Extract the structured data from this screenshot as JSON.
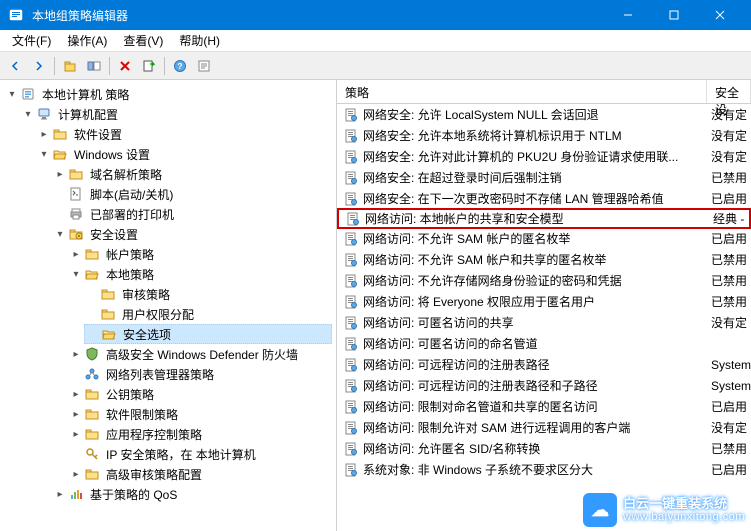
{
  "window": {
    "title": "本地组策略编辑器"
  },
  "menu": {
    "file": "文件(F)",
    "action": "操作(A)",
    "view": "查看(V)",
    "help": "帮助(H)"
  },
  "tree": {
    "root": "本地计算机 策略",
    "computer_config": "计算机配置",
    "software_settings": "软件设置",
    "windows_settings": "Windows 设置",
    "name_resolution": "域名解析策略",
    "scripts": "脚本(启动/关机)",
    "deployed_printers": "已部署的打印机",
    "security_settings": "安全设置",
    "account_policies": "帐户策略",
    "local_policies": "本地策略",
    "audit_policy": "审核策略",
    "user_rights": "用户权限分配",
    "security_options": "安全选项",
    "windows_defender": "高级安全 Windows Defender 防火墙",
    "network_list": "网络列表管理器策略",
    "public_key": "公钥策略",
    "software_restriction": "软件限制策略",
    "app_control": "应用程序控制策略",
    "ip_security": "IP 安全策略，在 本地计算机",
    "advanced_audit": "高级审核策略配置",
    "qos": "基于策略的 QoS"
  },
  "list": {
    "header_policy": "策略",
    "header_security": "安全设",
    "items": [
      {
        "label": "网络安全: 允许 LocalSystem NULL 会话回退",
        "value": "没有定"
      },
      {
        "label": "网络安全: 允许本地系统将计算机标识用于 NTLM",
        "value": "没有定"
      },
      {
        "label": "网络安全: 允许对此计算机的 PKU2U 身份验证请求使用联...",
        "value": "没有定"
      },
      {
        "label": "网络安全: 在超过登录时间后强制注销",
        "value": "已禁用"
      },
      {
        "label": "网络安全: 在下一次更改密码时不存储 LAN 管理器哈希值",
        "value": "已启用"
      },
      {
        "label": "网络访问: 本地帐户的共享和安全模型",
        "value": "经典 -",
        "highlight": true
      },
      {
        "label": "网络访问: 不允许 SAM 帐户的匿名枚举",
        "value": "已启用"
      },
      {
        "label": "网络访问: 不允许 SAM 帐户和共享的匿名枚举",
        "value": "已禁用"
      },
      {
        "label": "网络访问: 不允许存储网络身份验证的密码和凭据",
        "value": "已禁用"
      },
      {
        "label": "网络访问: 将 Everyone 权限应用于匿名用户",
        "value": "已禁用"
      },
      {
        "label": "网络访问: 可匿名访问的共享",
        "value": "没有定"
      },
      {
        "label": "网络访问: 可匿名访问的命名管道",
        "value": ""
      },
      {
        "label": "网络访问: 可远程访问的注册表路径",
        "value": "System"
      },
      {
        "label": "网络访问: 可远程访问的注册表路径和子路径",
        "value": "System"
      },
      {
        "label": "网络访问: 限制对命名管道和共享的匿名访问",
        "value": "已启用"
      },
      {
        "label": "网络访问: 限制允许对 SAM 进行远程调用的客户端",
        "value": "没有定"
      },
      {
        "label": "网络访问: 允许匿名 SID/名称转换",
        "value": "已禁用"
      },
      {
        "label": "系统对象: 非 Windows 子系统不要求区分大",
        "value": "已启用"
      }
    ]
  },
  "watermark": {
    "line1": "白云一键重装系统",
    "line2": "www.baiyunxitong.com"
  }
}
